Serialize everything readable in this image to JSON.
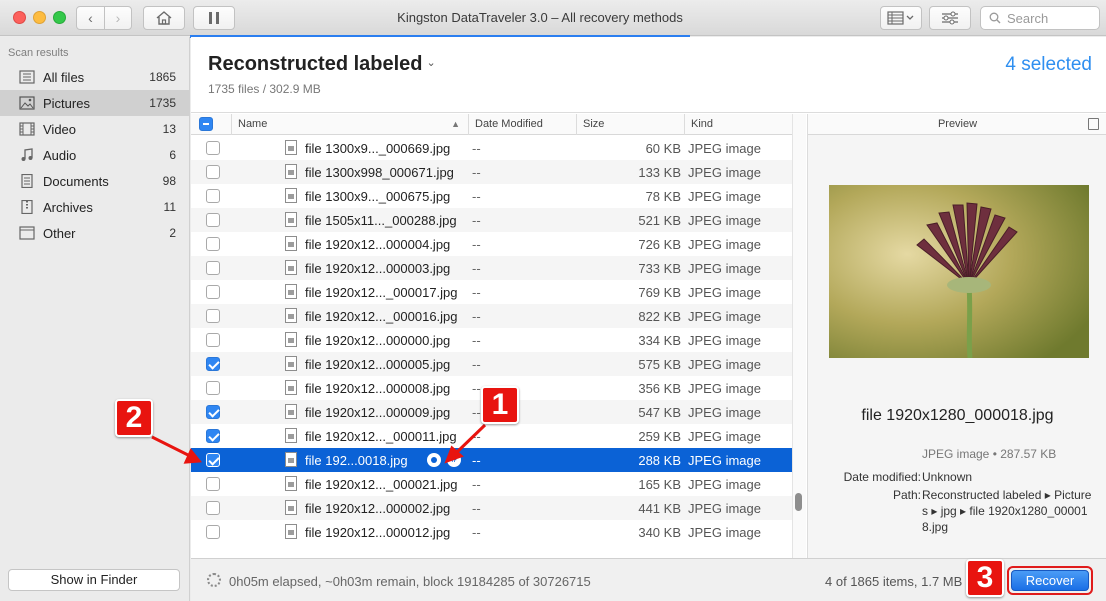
{
  "window": {
    "title": "Kingston DataTraveler 3.0 – All recovery methods",
    "search_placeholder": "Search"
  },
  "sidebar": {
    "heading": "Scan results",
    "items": [
      {
        "label": "All files",
        "count": "1865",
        "icon": "all-files-icon"
      },
      {
        "label": "Pictures",
        "count": "1735",
        "icon": "pictures-icon",
        "selected": true
      },
      {
        "label": "Video",
        "count": "13",
        "icon": "video-icon"
      },
      {
        "label": "Audio",
        "count": "6",
        "icon": "audio-icon"
      },
      {
        "label": "Documents",
        "count": "98",
        "icon": "documents-icon"
      },
      {
        "label": "Archives",
        "count": "11",
        "icon": "archives-icon"
      },
      {
        "label": "Other",
        "count": "2",
        "icon": "other-icon"
      }
    ],
    "show_in_finder": "Show in Finder"
  },
  "main": {
    "title": "Reconstructed labeled",
    "subtitle": "1735 files / 302.9 MB",
    "selected_count": "4 selected"
  },
  "table": {
    "columns": {
      "name": "Name",
      "date": "Date Modified",
      "size": "Size",
      "kind": "Kind"
    },
    "rows": [
      {
        "name": "file 1300x9..._000669.jpg",
        "date": "--",
        "size": "60 KB",
        "kind": "JPEG image",
        "checked": false
      },
      {
        "name": "file 1300x998_000671.jpg",
        "date": "--",
        "size": "133 KB",
        "kind": "JPEG image",
        "checked": false
      },
      {
        "name": "file 1300x9..._000675.jpg",
        "date": "--",
        "size": "78 KB",
        "kind": "JPEG image",
        "checked": false
      },
      {
        "name": "file 1505x11..._000288.jpg",
        "date": "--",
        "size": "521 KB",
        "kind": "JPEG image",
        "checked": false
      },
      {
        "name": "file 1920x12...000004.jpg",
        "date": "--",
        "size": "726 KB",
        "kind": "JPEG image",
        "checked": false
      },
      {
        "name": "file 1920x12...000003.jpg",
        "date": "--",
        "size": "733 KB",
        "kind": "JPEG image",
        "checked": false
      },
      {
        "name": "file 1920x12..._000017.jpg",
        "date": "--",
        "size": "769 KB",
        "kind": "JPEG image",
        "checked": false
      },
      {
        "name": "file 1920x12..._000016.jpg",
        "date": "--",
        "size": "822 KB",
        "kind": "JPEG image",
        "checked": false
      },
      {
        "name": "file 1920x12...000000.jpg",
        "date": "--",
        "size": "334 KB",
        "kind": "JPEG image",
        "checked": false
      },
      {
        "name": "file 1920x12...000005.jpg",
        "date": "--",
        "size": "575 KB",
        "kind": "JPEG image",
        "checked": true
      },
      {
        "name": "file 1920x12...000008.jpg",
        "date": "--",
        "size": "356 KB",
        "kind": "JPEG image",
        "checked": false
      },
      {
        "name": "file 1920x12...000009.jpg",
        "date": "--",
        "size": "547 KB",
        "kind": "JPEG image",
        "checked": true
      },
      {
        "name": "file 1920x12..._000011.jpg",
        "date": "--",
        "size": "259 KB",
        "kind": "JPEG image",
        "checked": true
      },
      {
        "name": "file 192...0018.jpg",
        "date": "--",
        "size": "288 KB",
        "kind": "JPEG image",
        "checked": true,
        "selected": true
      },
      {
        "name": "file 1920x12..._000021.jpg",
        "date": "--",
        "size": "165 KB",
        "kind": "JPEG image",
        "checked": false
      },
      {
        "name": "file 1920x12...000002.jpg",
        "date": "--",
        "size": "441 KB",
        "kind": "JPEG image",
        "checked": false
      },
      {
        "name": "file 1920x12...000012.jpg",
        "date": "--",
        "size": "340 KB",
        "kind": "JPEG image",
        "checked": false
      }
    ]
  },
  "preview": {
    "heading": "Preview",
    "file_name": "file 1920x1280_000018.jpg",
    "kind_size": "JPEG image • 287.57 KB",
    "date_label": "Date modified:",
    "date_value": "Unknown",
    "path_label": "Path:",
    "path_value": "Reconstructed labeled ▸ Pictures ▸ jpg ▸ file 1920x1280_000018.jpg"
  },
  "footer": {
    "status": "0h05m elapsed, ~0h03m remain, block 19184285 of 30726715",
    "count": "4 of 1865 items, 1.7 MB",
    "recover_label": "Recover"
  },
  "annotations": {
    "b1": "1",
    "b2": "2",
    "b3": "3"
  },
  "colors": {
    "accent": "#2f86f2",
    "selection": "#0b62d6",
    "annotation": "#e8140f"
  }
}
